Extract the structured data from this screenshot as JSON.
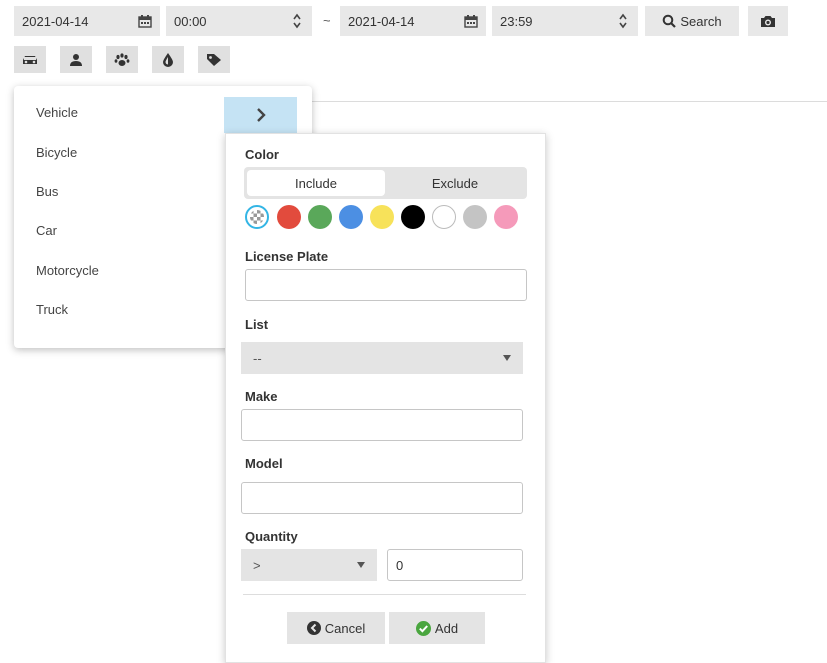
{
  "toolbar": {
    "start_date": "2021-04-14",
    "start_time": "00:00",
    "range_separator": "~",
    "end_date": "2021-04-14",
    "end_time": "23:59",
    "search_label": "Search",
    "filter_icons": [
      "car-icon",
      "person-icon",
      "paw-icon",
      "drop-icon",
      "tag-icon"
    ]
  },
  "menu": {
    "items": [
      "Vehicle",
      "Bicycle",
      "Bus",
      "Car",
      "Motorcycle",
      "Truck"
    ],
    "selected": "Vehicle"
  },
  "panel": {
    "color_label": "Color",
    "include_label": "Include",
    "exclude_label": "Exclude",
    "selected_mode": "Include",
    "colors": [
      "any",
      "#e24b3d",
      "#5aa85a",
      "#4c8fe3",
      "#f7e25a",
      "#000000",
      "#ffffff",
      "#c4c4c4",
      "#f59aba"
    ],
    "license_label": "License Plate",
    "license_value": "",
    "list_label": "List",
    "list_value": "--",
    "make_label": "Make",
    "make_value": "",
    "model_label": "Model",
    "model_value": "",
    "quantity_label": "Quantity",
    "quantity_operator": ">",
    "quantity_value": "0",
    "cancel_label": "Cancel",
    "add_label": "Add"
  }
}
